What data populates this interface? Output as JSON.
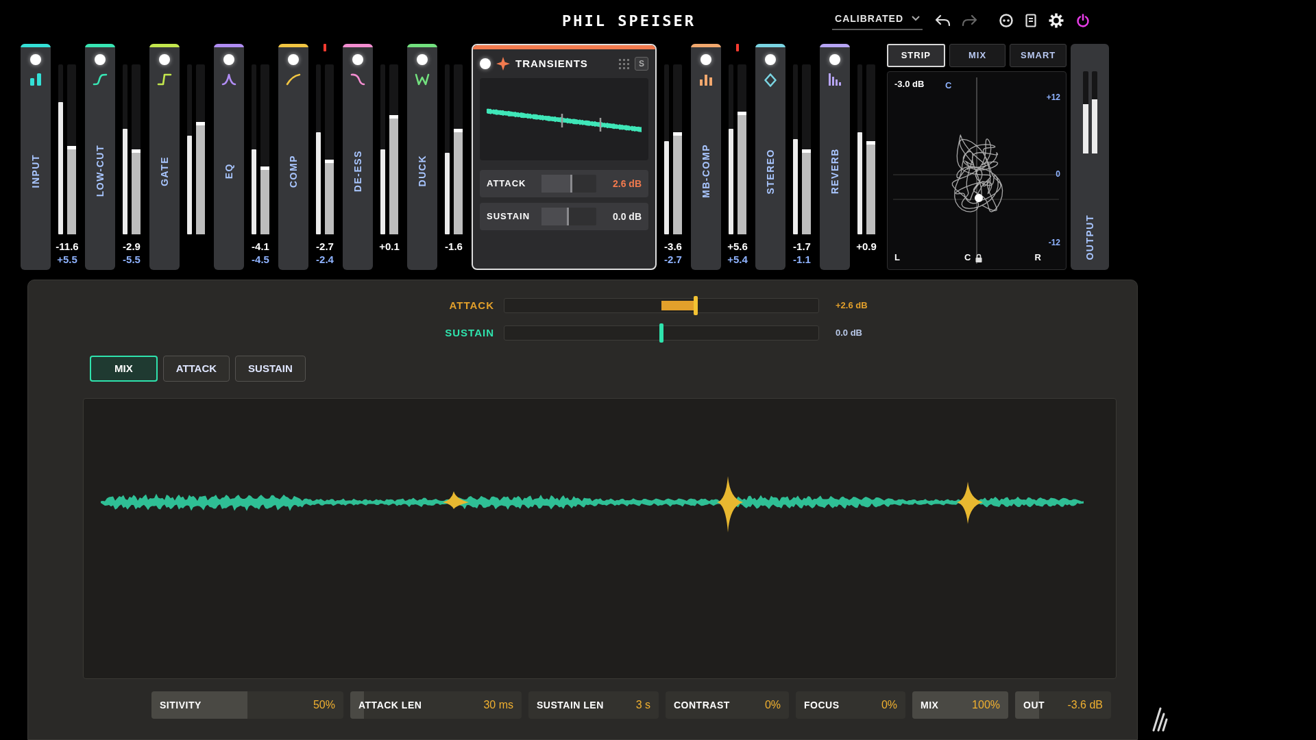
{
  "header": {
    "logo": "PHIL SPEISER",
    "preset": "CALIBRATED"
  },
  "view_tabs": [
    {
      "label": "STRIP",
      "selected": true
    },
    {
      "label": "MIX",
      "selected": false
    },
    {
      "label": "SMART",
      "selected": false
    }
  ],
  "modules": [
    {
      "kind": "strip",
      "name": "INPUT",
      "color": "#34e0d6",
      "on": true,
      "clip": false,
      "meters": [
        {
          "level": 0.78
        },
        {
          "level": 0.52
        }
      ],
      "readings": [
        "-11.6",
        "+5.5"
      ]
    },
    {
      "kind": "strip",
      "name": "LOW-CUT",
      "color": "#38e6b4",
      "on": true,
      "clip": false,
      "meters": [
        {
          "level": 0.62
        },
        {
          "level": 0.5
        }
      ],
      "readings": [
        "-2.9",
        "-5.5"
      ]
    },
    {
      "kind": "strip",
      "name": "GATE",
      "color": "#c3e74d",
      "on": true,
      "clip": false,
      "meters": [
        {
          "level": 0.58
        },
        {
          "level": 0.66
        }
      ]
    },
    {
      "kind": "strip",
      "name": "EQ",
      "color": "#b08cf3",
      "on": true,
      "clip": false,
      "meters": [
        {
          "level": 0.5
        },
        {
          "level": 0.4
        }
      ],
      "readings": [
        "-4.1",
        "-4.5"
      ]
    },
    {
      "kind": "strip",
      "name": "COMP",
      "color": "#f1c542",
      "on": true,
      "clip": true,
      "meters": [
        {
          "level": 0.6
        },
        {
          "level": 0.44
        }
      ],
      "readings": [
        "-2.7",
        "-2.4"
      ]
    },
    {
      "kind": "strip",
      "name": "DE-ESS",
      "color": "#f38dd0",
      "on": true,
      "clip": false,
      "meters": [
        {
          "level": 0.5
        },
        {
          "level": 0.7
        }
      ],
      "readings": [
        "+0.1"
      ]
    },
    {
      "kind": "strip",
      "name": "DUCK",
      "color": "#72e07e",
      "on": true,
      "clip": false,
      "meters": [
        {
          "level": 0.48
        },
        {
          "level": 0.62
        }
      ],
      "readings": [
        "-1.6"
      ]
    },
    {
      "kind": "panel",
      "name": "TRANSIENTS",
      "color": "#f27a4e",
      "on": true,
      "clip": false,
      "solo": "S",
      "params": [
        {
          "label": "ATTACK",
          "value": "2.6 dB",
          "level": 0.56
        },
        {
          "label": "SUSTAIN",
          "value": "0.0 dB",
          "level": 0.5
        }
      ],
      "meters": [
        {
          "level": 0.55
        },
        {
          "level": 0.6
        }
      ],
      "readings": [
        "-3.6",
        "-2.7"
      ]
    },
    {
      "kind": "strip",
      "name": "MB-COMP",
      "color": "#f2a86e",
      "on": true,
      "clip": true,
      "meters": [
        {
          "level": 0.62
        },
        {
          "level": 0.72
        }
      ],
      "readings": [
        "+5.6",
        "+5.4"
      ]
    },
    {
      "kind": "strip",
      "name": "STEREO",
      "color": "#7ad4e2",
      "on": true,
      "clip": false,
      "meters": [
        {
          "level": 0.56
        },
        {
          "level": 0.5
        }
      ],
      "readings": [
        "-1.7",
        "-1.1"
      ]
    },
    {
      "kind": "strip",
      "name": "REVERB",
      "color": "#b6a4f4",
      "on": true,
      "clip": false,
      "meters": [
        {
          "level": 0.6
        },
        {
          "level": 0.55
        }
      ],
      "readings": [
        "+0.9"
      ]
    }
  ],
  "vectorscope": {
    "gain": "-3.0 dB",
    "top": "C",
    "bottom": "C",
    "left": "L",
    "right": "R",
    "scale": [
      "+12",
      "0",
      "-12"
    ]
  },
  "output": {
    "label": "OUTPUT",
    "meters": [
      {
        "level": 0.6
      },
      {
        "level": 0.66
      }
    ]
  },
  "macro": {
    "rows": [
      {
        "label": "ATTACK",
        "color": "#e3a02b",
        "level": 0.61,
        "value": "+2.6 dB"
      },
      {
        "label": "SUSTAIN",
        "color": "#2fe3ad",
        "level": 0.5,
        "value": "0.0 dB"
      }
    ]
  },
  "editor_tabs": [
    {
      "label": "MIX",
      "selected": true
    },
    {
      "label": "ATTACK",
      "selected": false
    },
    {
      "label": "SUSTAIN",
      "selected": false
    }
  ],
  "bottom_params": [
    {
      "label": "SITIVITY",
      "value": "50%",
      "level": 0.5
    },
    {
      "label": "ATTACK LEN",
      "value": "30 ms",
      "level": 0.08
    },
    {
      "label": "SUSTAIN LEN",
      "value": "3 s"
    },
    {
      "label": "CONTRAST",
      "value": "0%"
    },
    {
      "label": "FOCUS",
      "value": "0%"
    },
    {
      "label": "MIX",
      "value": "100%",
      "level": 1
    },
    {
      "label": "OUT",
      "value": "-3.6 dB",
      "level": 0.25
    }
  ]
}
